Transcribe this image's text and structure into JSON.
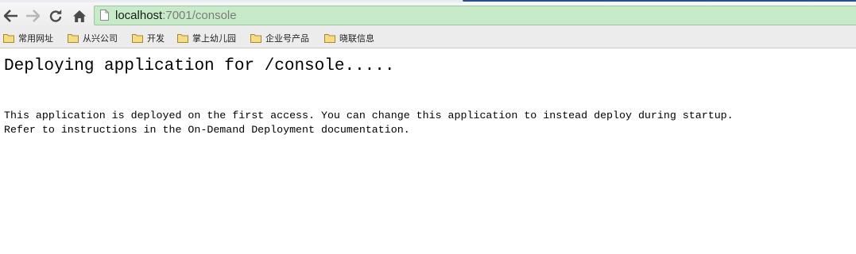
{
  "browser": {
    "url_host": "localhost",
    "url_rest": ":7001/console",
    "omnibox_color": "#c7ebc9",
    "icons": {
      "back": "back-arrow-icon",
      "forward": "forward-arrow-icon",
      "reload": "reload-icon",
      "home": "home-icon",
      "page": "page-icon"
    }
  },
  "bookmarks": [
    {
      "label": "常用网址",
      "icon": "folder-icon"
    },
    {
      "label": "从兴公司",
      "icon": "folder-icon"
    },
    {
      "label": "开发",
      "icon": "folder-icon"
    },
    {
      "label": "掌上幼儿园",
      "icon": "folder-icon"
    },
    {
      "label": "企业号产品",
      "icon": "folder-icon"
    },
    {
      "label": "晓联信息",
      "icon": "folder-icon"
    }
  ],
  "page": {
    "heading": "Deploying application for /console.....",
    "line1": "This application is deployed on the first access. You can change this application to instead deploy during startup.",
    "line2": "Refer to instructions in the On-Demand Deployment documentation."
  }
}
